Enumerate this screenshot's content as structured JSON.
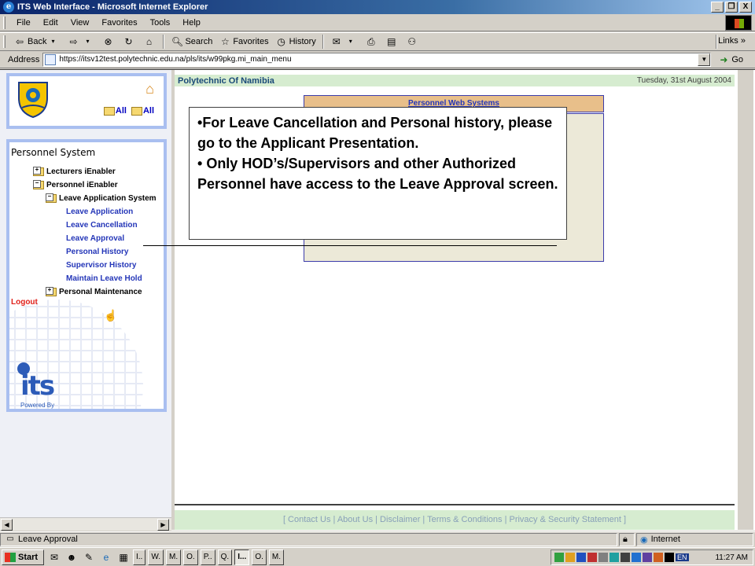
{
  "window": {
    "title": "ITS Web Interface - Microsoft Internet Explorer",
    "controls": [
      "_",
      "❐",
      "X"
    ]
  },
  "menubar": {
    "items": [
      "File",
      "Edit",
      "View",
      "Favorites",
      "Tools",
      "Help"
    ]
  },
  "toolbar": {
    "back": "Back",
    "search": "Search",
    "favorites": "Favorites",
    "history": "History",
    "links": "Links"
  },
  "address": {
    "label": "Address",
    "url": "https://itsv12test.polytechnic.edu.na/pls/its/w99pkg.mi_main_menu",
    "go": "Go"
  },
  "sidebar": {
    "all_expand": "All",
    "all_collapse": "All",
    "header": "Personnel System",
    "items": [
      {
        "label": "Lecturers iEnabler",
        "kind": "folder"
      },
      {
        "label": "Personnel iEnabler",
        "kind": "folder"
      },
      {
        "label": "Leave Application System",
        "kind": "folder"
      },
      {
        "label": "Leave Application",
        "kind": "link"
      },
      {
        "label": "Leave Cancellation",
        "kind": "link"
      },
      {
        "label": "Leave Approval",
        "kind": "link"
      },
      {
        "label": "Personal History",
        "kind": "link"
      },
      {
        "label": "Supervisor History",
        "kind": "link"
      },
      {
        "label": "Maintain Leave Hold",
        "kind": "link"
      },
      {
        "label": "Personal Maintenance",
        "kind": "folder"
      }
    ],
    "logout": "Logout",
    "powered_by": "Powered By",
    "its_logo_text": "its"
  },
  "main": {
    "org": "Polytechnic Of Namibia",
    "date": "Tuesday, 31st August 2004",
    "section_tab": "Personnel Web Systems",
    "footer": "[ Contact Us | About Us | Disclaimer | Terms & Conditions | Privacy & Security Statement ]"
  },
  "callout": {
    "lines": [
      "For Leave Cancellation and Personal history, please go to the Applicant Presentation.",
      "Only HOD’s/Supervisors and other Authorized Personnel have access to the Leave Approval screen."
    ]
  },
  "statusbar": {
    "text": "Leave Approval",
    "zone": "Internet"
  },
  "taskbar": {
    "start": "Start",
    "tasks": [
      {
        "label": "I..",
        "active": false
      },
      {
        "label": "W.",
        "active": false
      },
      {
        "label": "M.",
        "active": false
      },
      {
        "label": "O.",
        "active": false
      },
      {
        "label": "P..",
        "active": false
      },
      {
        "label": "Q.",
        "active": false
      },
      {
        "label": "I...",
        "active": true
      },
      {
        "label": "O.",
        "active": false
      },
      {
        "label": "M.",
        "active": false
      }
    ],
    "lang": "EN",
    "clock": "11:27 AM"
  },
  "colors": {
    "header_band": "#d6ecd0",
    "section_tab": "#e8bf8a",
    "nav_link": "#2436b8",
    "logout": "#e0201a",
    "sidebar_border": "#a9bff0"
  }
}
